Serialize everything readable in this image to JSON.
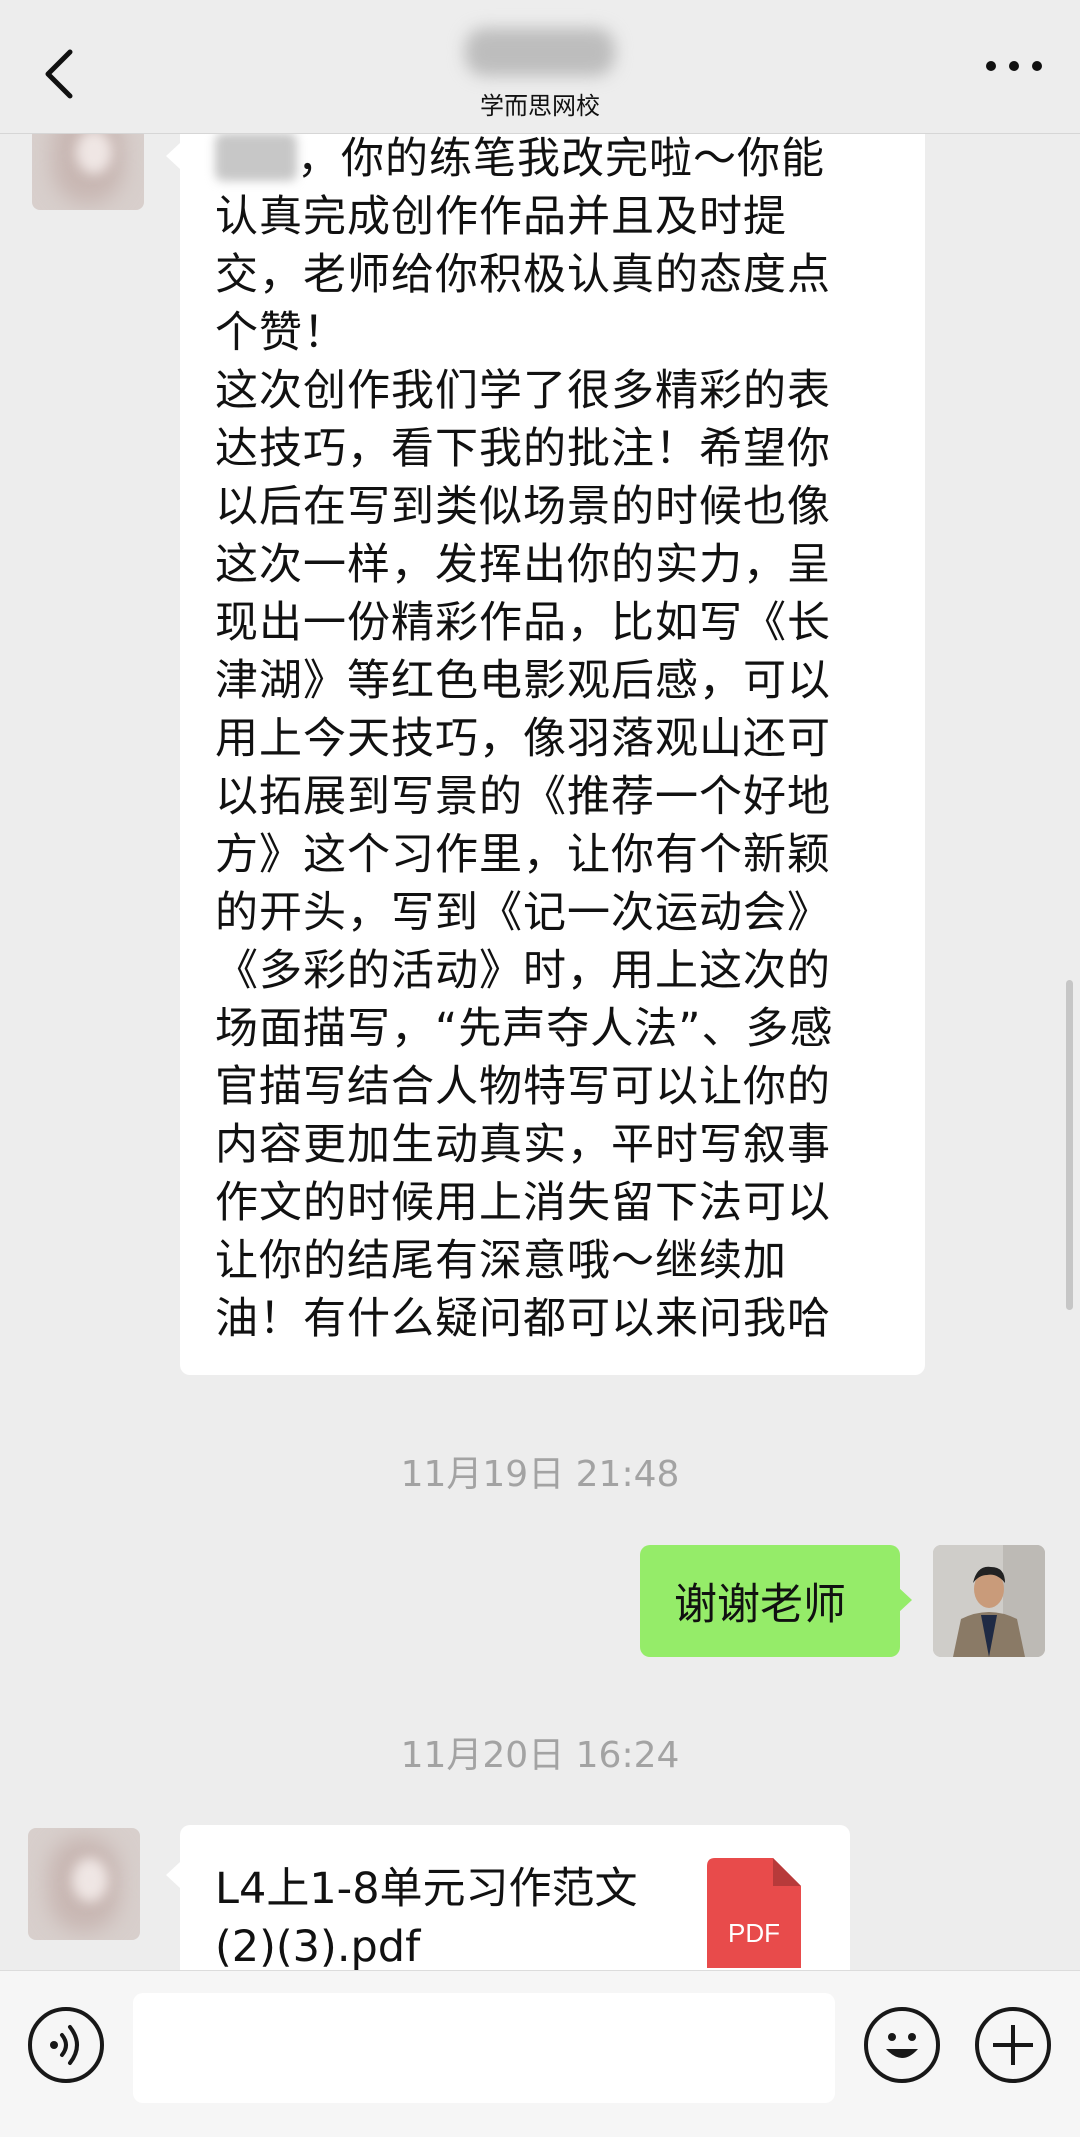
{
  "header": {
    "subtitle": "学而思网校",
    "back_icon": "chevron-left-icon",
    "more_icon": "more-dots-icon"
  },
  "messages": {
    "teacher_message_lines": [
      "，你的练笔我改完啦～你能",
      "认真完成创作作品并且及时提",
      "交，老师给你积极认真的态度点",
      "个赞！",
      "这次创作我们学了很多精彩的表",
      "达技巧，看下我的批注！希望你",
      "以后在写到类似场景的时候也像",
      "这次一样，发挥出你的实力，呈",
      "现出一份精彩作品，比如写《长",
      "津湖》等红色电影观后感，可以",
      "用上今天技巧，像羽落观山还可",
      "以拓展到写景的《推荐一个好地",
      "方》这个习作里，让你有个新颖",
      "的开头，写到《记一次运动会》",
      "《多彩的活动》时，用上这次的",
      "场面描写，“先声夺人法”、多感",
      "官描写结合人物特写可以让你的",
      "内容更加生动真实，平时写叙事",
      "作文的时候用上消失留下法可以",
      "让你的结尾有深意哦～继续加",
      "油！有什么疑问都可以来问我哈"
    ],
    "timestamp_1": "11月19日 21:48",
    "my_reply": "谢谢老师",
    "timestamp_2": "11月20日 16:24",
    "file_name": "L4上1-8单元习作范文(2)(3).pdf",
    "file_badge": "PDF",
    "file_color": "#e84b4b"
  },
  "toolbar": {
    "voice_icon": "voice-icon",
    "emoji_icon": "emoji-icon",
    "plus_icon": "plus-icon",
    "input_value": ""
  },
  "colors": {
    "background": "#ededed",
    "my_bubble": "#95ec69",
    "other_bubble": "#ffffff"
  }
}
